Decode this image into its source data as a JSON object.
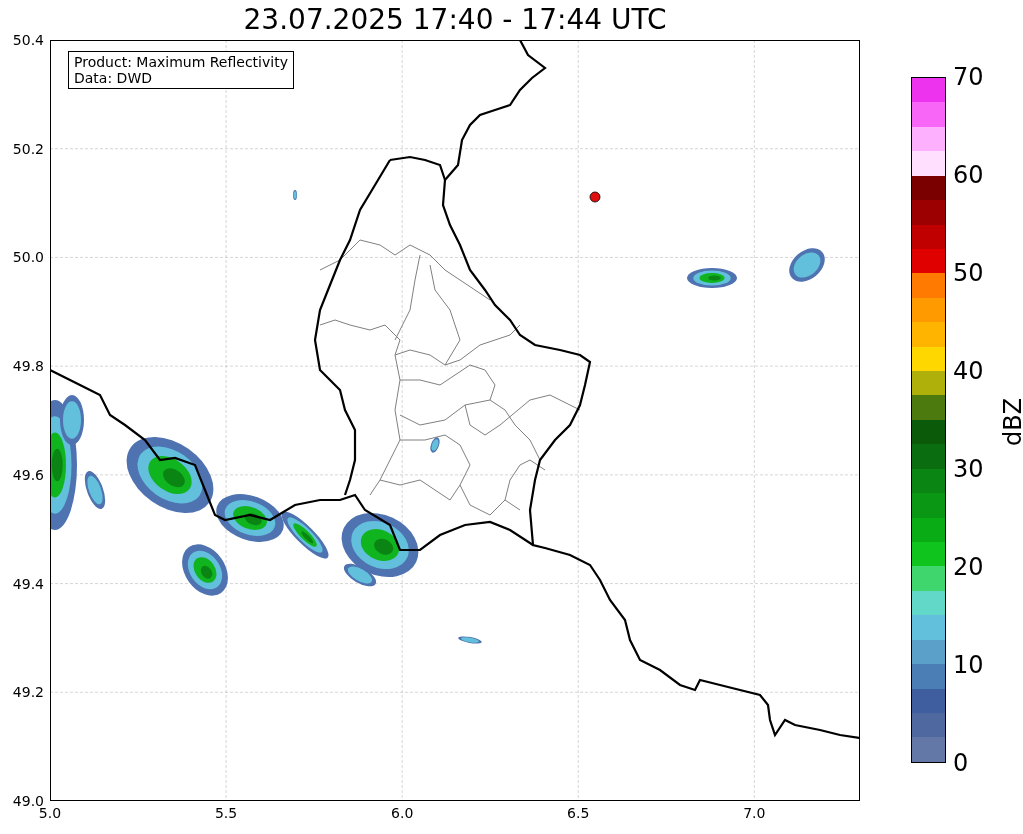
{
  "title": "23.07.2025 17:40 - 17:44 UTC",
  "info_box": [
    "Product: Maximum Reflectivity",
    "Data: DWD"
  ],
  "x_ticks": [
    "5.0",
    "5.5",
    "6.0",
    "6.5",
    "7.0"
  ],
  "y_ticks": [
    "50.4",
    "50.2",
    "50.0",
    "49.8",
    "49.6",
    "49.4",
    "49.2",
    "49.0"
  ],
  "colorbar": {
    "label": "dBZ",
    "ticks": [
      "70",
      "60",
      "50",
      "40",
      "30",
      "20",
      "10",
      "0"
    ],
    "segments": [
      {
        "color": "#ee33ee"
      },
      {
        "color": "#f766f7"
      },
      {
        "color": "#fdb0fd"
      },
      {
        "color": "#ffdffd"
      },
      {
        "color": "#7a0000"
      },
      {
        "color": "#9d0000"
      },
      {
        "color": "#c00000"
      },
      {
        "color": "#e10000"
      },
      {
        "color": "#ff7a00"
      },
      {
        "color": "#ff9a00"
      },
      {
        "color": "#ffb400"
      },
      {
        "color": "#ffd700"
      },
      {
        "color": "#b0b00a"
      },
      {
        "color": "#4c7a0e"
      },
      {
        "color": "#0a5a0a"
      },
      {
        "color": "#0a6e10"
      },
      {
        "color": "#0a8412"
      },
      {
        "color": "#0a9814"
      },
      {
        "color": "#0aac16"
      },
      {
        "color": "#10c41e"
      },
      {
        "color": "#3fd66e"
      },
      {
        "color": "#62d8c8"
      },
      {
        "color": "#62c0dc"
      },
      {
        "color": "#5aa0c8"
      },
      {
        "color": "#4a7eb4"
      },
      {
        "color": "#3e5ea0"
      },
      {
        "color": "#4f68a0"
      },
      {
        "color": "#6478a8"
      }
    ]
  }
}
